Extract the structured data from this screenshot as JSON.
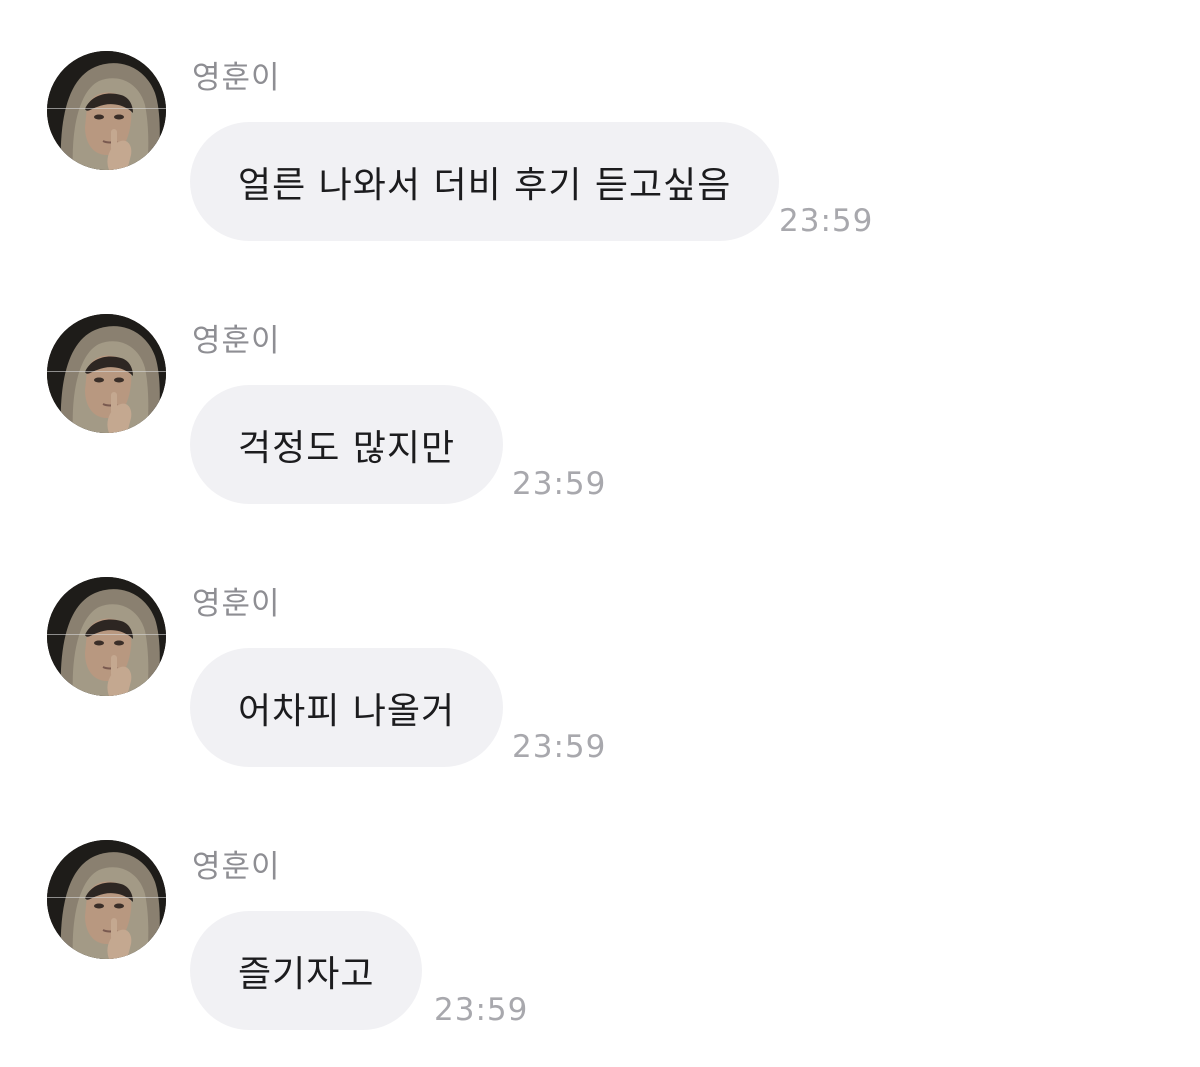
{
  "chat": {
    "messages": [
      {
        "sender": "영훈이",
        "avatar_icon": "profile-photo-hooded-person",
        "text": "얼른 나와서 더비 후기 듣고싶음",
        "time": "23:59"
      },
      {
        "sender": "영훈이",
        "avatar_icon": "profile-photo-hooded-person",
        "text": "걱정도 많지만",
        "time": "23:59"
      },
      {
        "sender": "영훈이",
        "avatar_icon": "profile-photo-hooded-person",
        "text": "어차피 나올거",
        "time": "23:59"
      },
      {
        "sender": "영훈이",
        "avatar_icon": "profile-photo-hooded-person",
        "text": "즐기자고",
        "time": "23:59"
      }
    ]
  },
  "colors": {
    "background": "#ffffff",
    "bubble": "#f1f1f4",
    "message_text": "#1c1c1e",
    "sender_text": "#8e8e93",
    "time_text": "#a8a8ad"
  }
}
